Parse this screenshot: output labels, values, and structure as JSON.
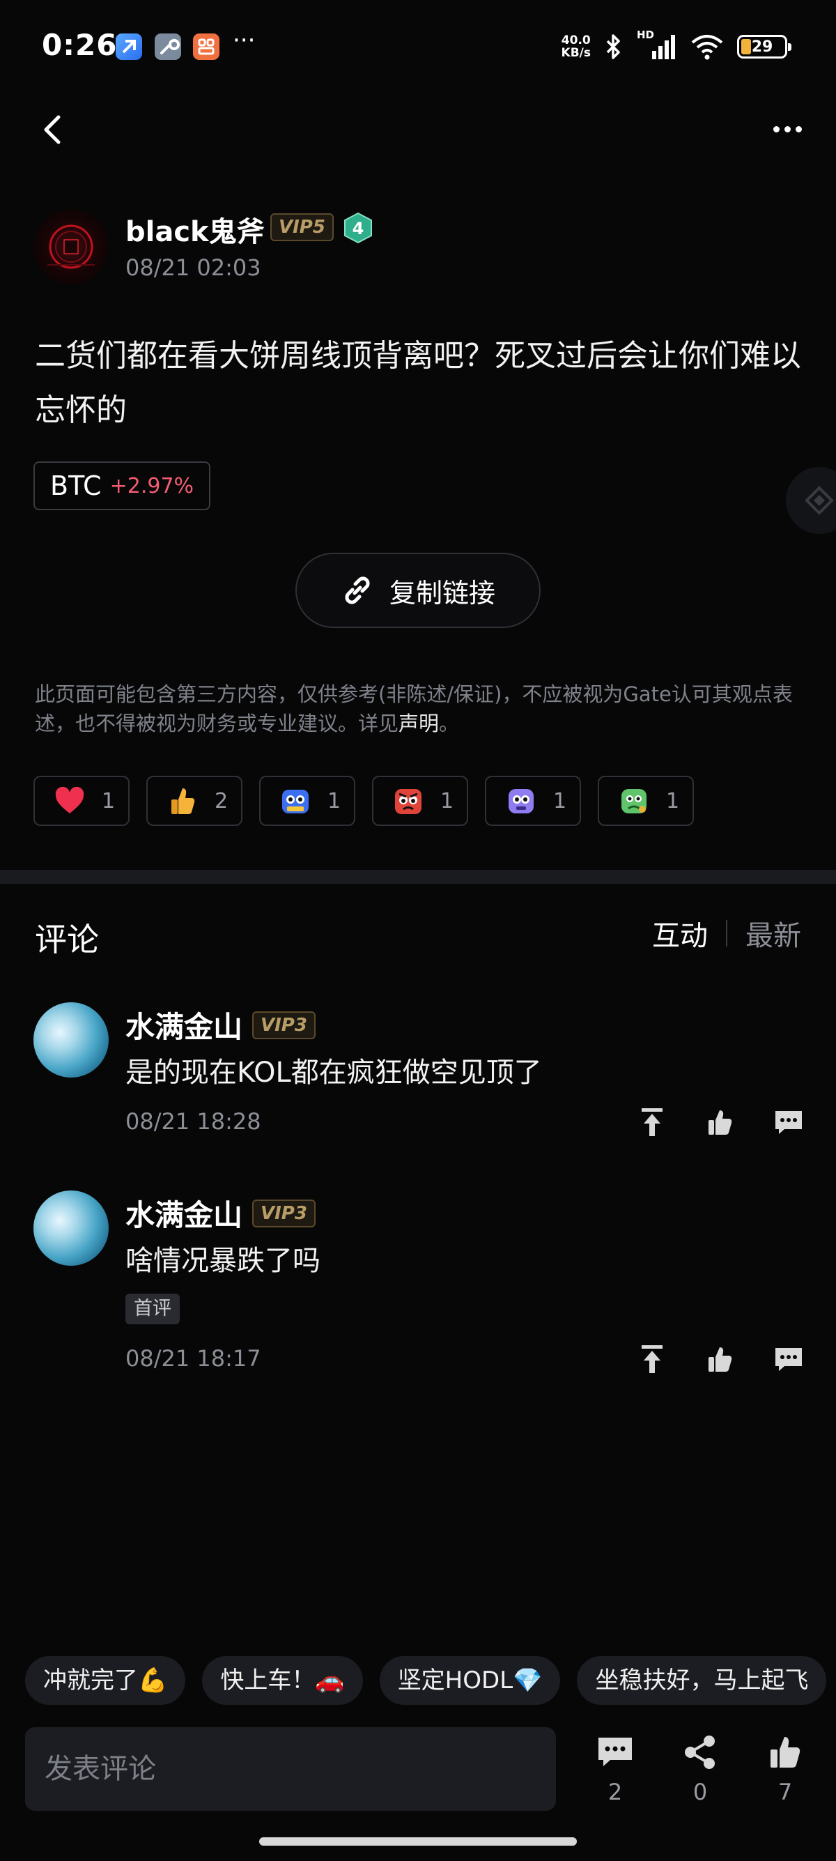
{
  "status_bar": {
    "time": "0:26",
    "more": "···",
    "net_speed_value": "40.0",
    "net_speed_unit": "KB/s",
    "hd": "HD",
    "battery": "29",
    "icons": [
      "app-icon-blue",
      "wrench-app-icon",
      "orange-app-icon",
      "bluetooth-icon",
      "signal-icon",
      "wifi-icon",
      "battery-icon"
    ]
  },
  "nav": {
    "back": "chevron-left-icon",
    "more": "more-dots-icon"
  },
  "post": {
    "author": "black鬼斧",
    "vip": "VIP5",
    "level": "4",
    "date": "08/21 02:03",
    "text": "二货们都在看大饼周线顶背离吧？死叉过后会让你们难以忘怀的",
    "coin": {
      "name": "BTC",
      "change": "+2.97%",
      "change_color": "#f25d72"
    },
    "copy_link": "复制链接",
    "disclaimer": "此页面可能包含第三方内容，仅供参考(非陈述/保证)，不应被视为Gate认可其观点表述，也不得被视为财务或专业建议。详见",
    "disclaimer_link": "声明",
    "disclaimer_end": "。",
    "reactions": [
      {
        "icon": "heart-icon",
        "count": "1"
      },
      {
        "icon": "thumbs-up-emoji-icon",
        "count": "2"
      },
      {
        "icon": "hodl-robot-icon",
        "count": "1"
      },
      {
        "icon": "angry-face-icon",
        "count": "1"
      },
      {
        "icon": "purple-ghost-icon",
        "count": "1"
      },
      {
        "icon": "green-sick-icon",
        "count": "1"
      }
    ]
  },
  "comments_section": {
    "title": "评论",
    "sort_active": "互动",
    "sort_inactive": "最新",
    "items": [
      {
        "user": "水满金山",
        "vip": "VIP3",
        "text": "是的现在KOL都在疯狂做空见顶了",
        "date": "08/21 18:28",
        "tag": ""
      },
      {
        "user": "水满金山",
        "vip": "VIP3",
        "text": "啥情况暴跌了吗",
        "date": "08/21 18:17",
        "tag": "首评"
      }
    ]
  },
  "quick_replies": [
    "冲就完了💪",
    "快上车！🚗",
    "坚定HODL💎",
    "坐稳扶好，马上起飞"
  ],
  "bottom_bar": {
    "input_placeholder": "发表评论",
    "comments": "2",
    "shares": "0",
    "likes": "7"
  },
  "colors": {
    "background": "#070708",
    "positive_change": "#f25d72",
    "vip_gold": "#b89d66"
  }
}
